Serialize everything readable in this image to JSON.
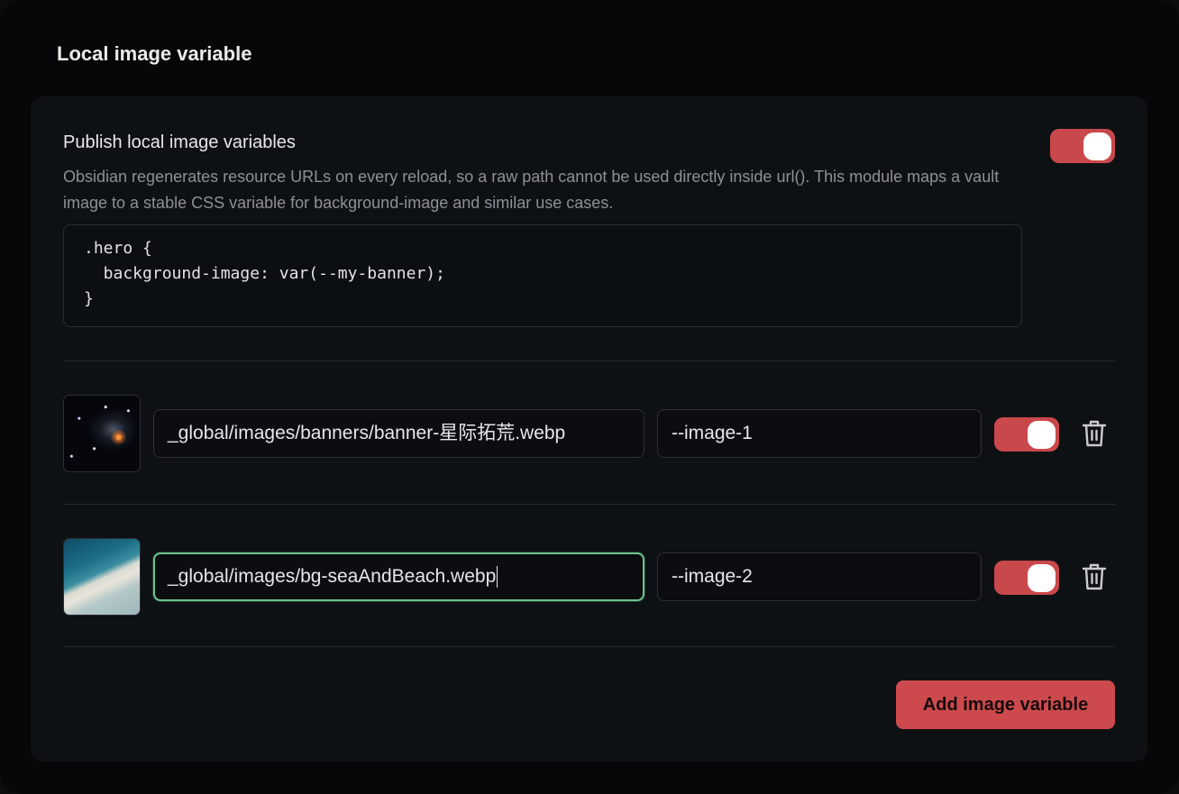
{
  "section": {
    "title": "Local image variable"
  },
  "setting": {
    "name": "Publish local image variables",
    "description": "Obsidian regenerates resource URLs on every reload, so a raw path cannot be used directly inside url(). This module maps a vault image to a stable CSS variable for background-image and similar use cases.",
    "enabled": true,
    "code_example": ".hero {\n  background-image: var(--my-banner);\n}"
  },
  "variables": [
    {
      "path": "_global/images/banners/banner-星际拓荒.webp",
      "name": "--image-1",
      "enabled": true,
      "thumbnail": "space-scene"
    },
    {
      "path": "_global/images/bg-seaAndBeach.webp",
      "name": "--image-2",
      "enabled": true,
      "thumbnail": "sea-and-beach",
      "focused": true
    }
  ],
  "actions": {
    "add_label": "Add image variable"
  },
  "colors": {
    "accent": "#cc4a4d",
    "focus_ring": "#6cc48f",
    "background": "#0e1114"
  },
  "icons": {
    "delete": "trash-icon"
  }
}
